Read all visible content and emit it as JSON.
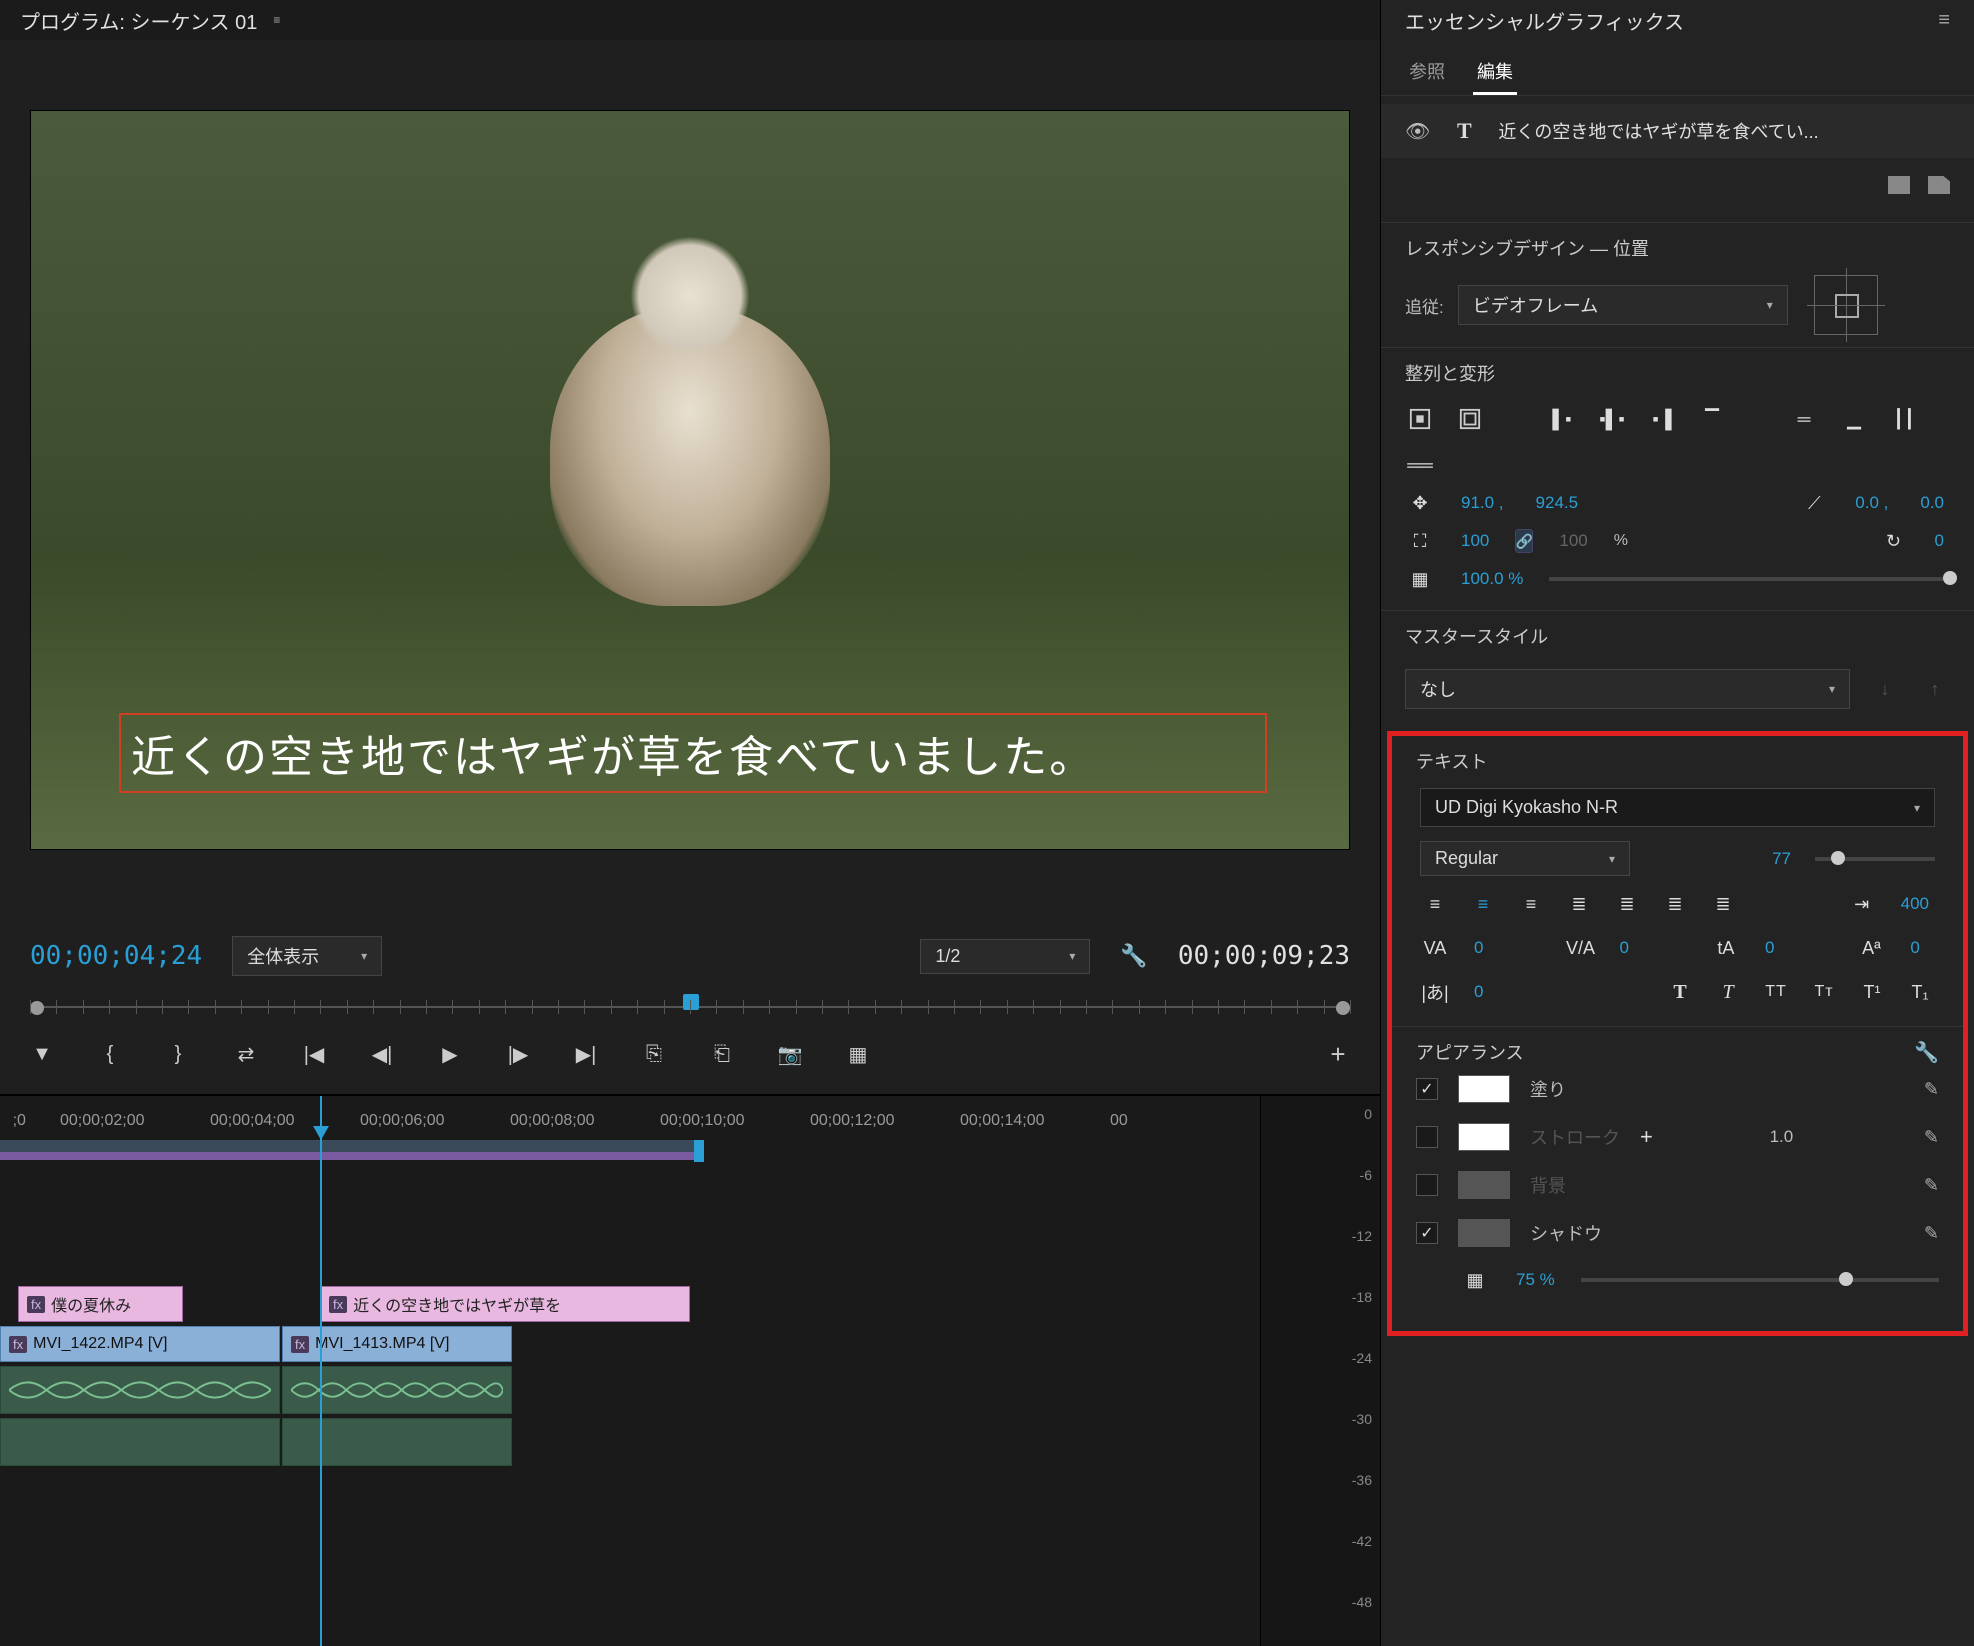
{
  "program": {
    "title": "プログラム: シーケンス 01",
    "caption": "近くの空き地ではヤギが草を食べていました。",
    "timecode_current": "00;00;04;24",
    "timecode_duration": "00;00;09;23",
    "fit": "全体表示",
    "resolution": "1/2"
  },
  "timeline": {
    "markers": [
      "00;00;02;00",
      "00;00;04;00",
      "00;00;06;00",
      "00;00;08;00",
      "00;00;10;00",
      "00;00;12;00",
      "00;00;14;00"
    ],
    "markers_end": "00",
    "playhead_pct": 28.6,
    "text_clip_1": "僕の夏休み",
    "text_clip_2": "近くの空き地ではヤギが草を",
    "video_clip_1": "MVI_1422.MP4 [V]",
    "video_clip_2": "MVI_1413.MP4 [V]",
    "meter_labels": [
      "0",
      "-6",
      "-12",
      "-18",
      "-24",
      "-30",
      "-36",
      "-42",
      "-48"
    ]
  },
  "eg": {
    "panel_title": "エッセンシャルグラフィックス",
    "tab_browse": "参照",
    "tab_edit": "編集",
    "layer_name": "近くの空き地ではヤギが草を食べてい...",
    "responsive_title": "レスポンシブデザイン — 位置",
    "follow_label": "追従:",
    "follow_value": "ビデオフレーム",
    "align_title": "整列と変形",
    "master_title": "マスタースタイル",
    "master_value": "なし",
    "text_title": "テキスト",
    "appearance_title": "アピアランス"
  },
  "transform": {
    "pos_x": "91.0 ,",
    "pos_y": "924.5",
    "anchor_x": "0.0 ,",
    "anchor_y": "0.0",
    "scale_w": "100",
    "scale_h": "100",
    "pct": "%",
    "rotation": "0",
    "opacity": "100.0 %"
  },
  "text": {
    "font": "UD Digi Kyokasho N-R",
    "weight": "Regular",
    "size": "77",
    "track_val": "400",
    "kern": "0",
    "va": "0",
    "leading": "0",
    "baseline": "0",
    "tsume": "0"
  },
  "appearance": {
    "fill_label": "塗り",
    "stroke_label": "ストローク",
    "stroke_width": "1.0",
    "bg_label": "背景",
    "shadow_label": "シャドウ",
    "shadow_opacity": "75 %"
  }
}
